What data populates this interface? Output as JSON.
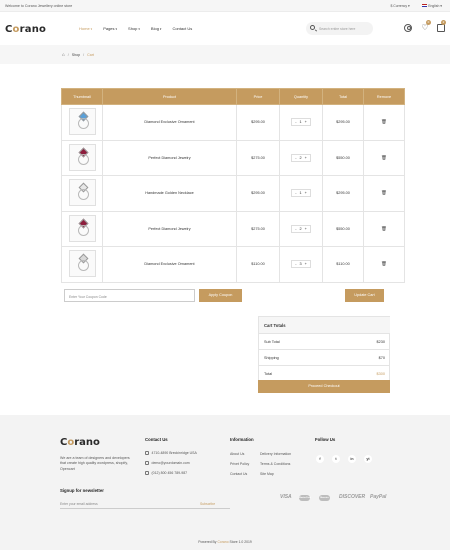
{
  "topbar": {
    "welcome": "Welcome to Corano Jewellery online store",
    "currency": "$ Currency",
    "language": "English"
  },
  "header": {
    "logo_pre": "C",
    "logo_o": "o",
    "logo_post": "rano",
    "nav": [
      {
        "label": "Home",
        "active": true
      },
      {
        "label": "Pages",
        "active": false
      },
      {
        "label": "Shop",
        "active": false
      },
      {
        "label": "Blog",
        "active": false
      },
      {
        "label": "Contact Us",
        "active": false
      }
    ],
    "search_placeholder": "Search entire store here",
    "wishlist_count": "0",
    "cart_count": "2"
  },
  "breadcrumb": {
    "home_icon": "home-icon",
    "items": [
      "Shop",
      "Cart"
    ]
  },
  "cart": {
    "columns": [
      "Thumbnail",
      "Product",
      "Price",
      "Quantity",
      "Total",
      "Remove"
    ],
    "rows": [
      {
        "product": "Diamond Exclusive Ornament",
        "price": "$295.00",
        "qty": "1",
        "total": "$295.00",
        "gem_color": "#5aa0d8"
      },
      {
        "product": "Perfect Diamond Jewelry",
        "price": "$275.00",
        "qty": "2",
        "total": "$550.00",
        "gem_color": "#8e1d3c"
      },
      {
        "product": "Handmade Golden Necklace",
        "price": "$295.00",
        "qty": "1",
        "total": "$295.00",
        "gem_color": "#e8e8e8"
      },
      {
        "product": "Perfect Diamond Jewelry",
        "price": "$275.00",
        "qty": "2",
        "total": "$550.00",
        "gem_color": "#8e1d3c"
      },
      {
        "product": "Diamond Exclusive Ornament",
        "price": "$110.00",
        "qty": "3",
        "total": "$110.00",
        "gem_color": "#d9d9d9"
      }
    ],
    "minus": "-",
    "plus": "+",
    "remove_icon": "trash-icon"
  },
  "coupon": {
    "placeholder": "Enter Your Coupon Code",
    "apply_label": "Apply Coupon",
    "update_label": "Update Cart"
  },
  "totals": {
    "title": "Cart Totals",
    "subtotal_label": "Sub Total",
    "subtotal_value": "$230",
    "shipping_label": "Shipping",
    "shipping_value": "$70",
    "total_label": "Total",
    "total_value": "$300",
    "checkout_label": "Proceed Checkout"
  },
  "footer": {
    "about": "We are a team of designers and developers that create high quality wordpress, shopify, Opencart",
    "contact_title": "Contact Us",
    "contact": [
      "4710-4890 Breckinridge USA",
      "demo@yourdomain.com",
      "(012) 800 456 789-987"
    ],
    "info_title": "Information",
    "info_col1": [
      "About Us",
      "Privet Policy",
      "Contact Us"
    ],
    "info_col2": [
      "Delivery Information",
      "Terms & Conditions",
      "Site Map"
    ],
    "follow_title": "Follow Us",
    "socials": [
      "f",
      "t",
      "in",
      "yt"
    ],
    "newsletter_title": "Signup for newsletter",
    "newsletter_placeholder": "Enter your email address",
    "subscribe_label": "Subscribe",
    "payments": [
      "VISA",
      "MasterCard",
      "Maestro",
      "DISCOVER",
      "PayPal"
    ],
    "copyright_pre": "Powered By",
    "copyright_brand": "Corano",
    "copyright_post": "Store 1.0 2019"
  },
  "colors": {
    "accent": "#c59b5f"
  }
}
